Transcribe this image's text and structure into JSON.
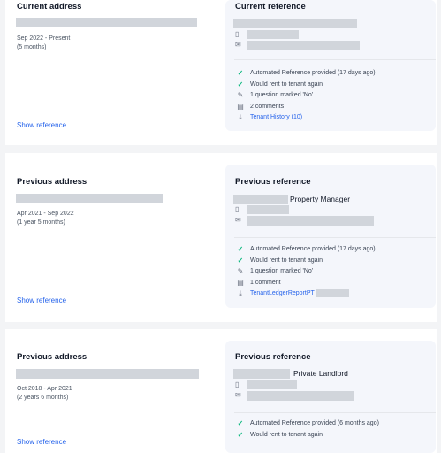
{
  "addresses": [
    {
      "heading": "Current address",
      "dates": "Sep 2022 - Present",
      "duration": "(5 months)",
      "show_reference": "Show reference",
      "reference": {
        "heading": "Current reference",
        "role": "",
        "items": [
          {
            "icon": "check-icon",
            "text": "Automated Reference provided (17 days ago)",
            "link": false
          },
          {
            "icon": "check-icon",
            "text": "Would rent to tenant again",
            "link": false
          },
          {
            "icon": "pencil-icon",
            "text": "1 question marked 'No'",
            "link": false
          },
          {
            "icon": "document-icon",
            "text": "2 comments",
            "link": false
          },
          {
            "icon": "download-icon",
            "text": "Tenant History (10)",
            "link": true
          }
        ]
      }
    },
    {
      "heading": "Previous address",
      "dates": "Apr 2021 - Sep 2022",
      "duration": "(1 year 5 months)",
      "show_reference": "Show reference",
      "reference": {
        "heading": "Previous reference",
        "role": "Property Manager",
        "items": [
          {
            "icon": "check-icon",
            "text": "Automated Reference provided (17 days ago)",
            "link": false
          },
          {
            "icon": "check-icon",
            "text": "Would rent to tenant again",
            "link": false
          },
          {
            "icon": "pencil-icon",
            "text": "1 question marked 'No'",
            "link": false
          },
          {
            "icon": "document-icon",
            "text": "1 comment",
            "link": false
          },
          {
            "icon": "download-icon",
            "text": "TenantLedgerReportPT",
            "link": true
          }
        ]
      }
    },
    {
      "heading": "Previous address",
      "dates": "Oct 2018 - Apr 2021",
      "duration": "(2 years 6 months)",
      "show_reference": "Show reference",
      "reference": {
        "heading": "Previous reference",
        "role": "Private Landlord",
        "items": [
          {
            "icon": "check-icon",
            "text": "Automated Reference provided (6 months ago)",
            "link": false
          },
          {
            "icon": "check-icon",
            "text": "Would rent to tenant again",
            "link": false
          }
        ]
      }
    }
  ]
}
